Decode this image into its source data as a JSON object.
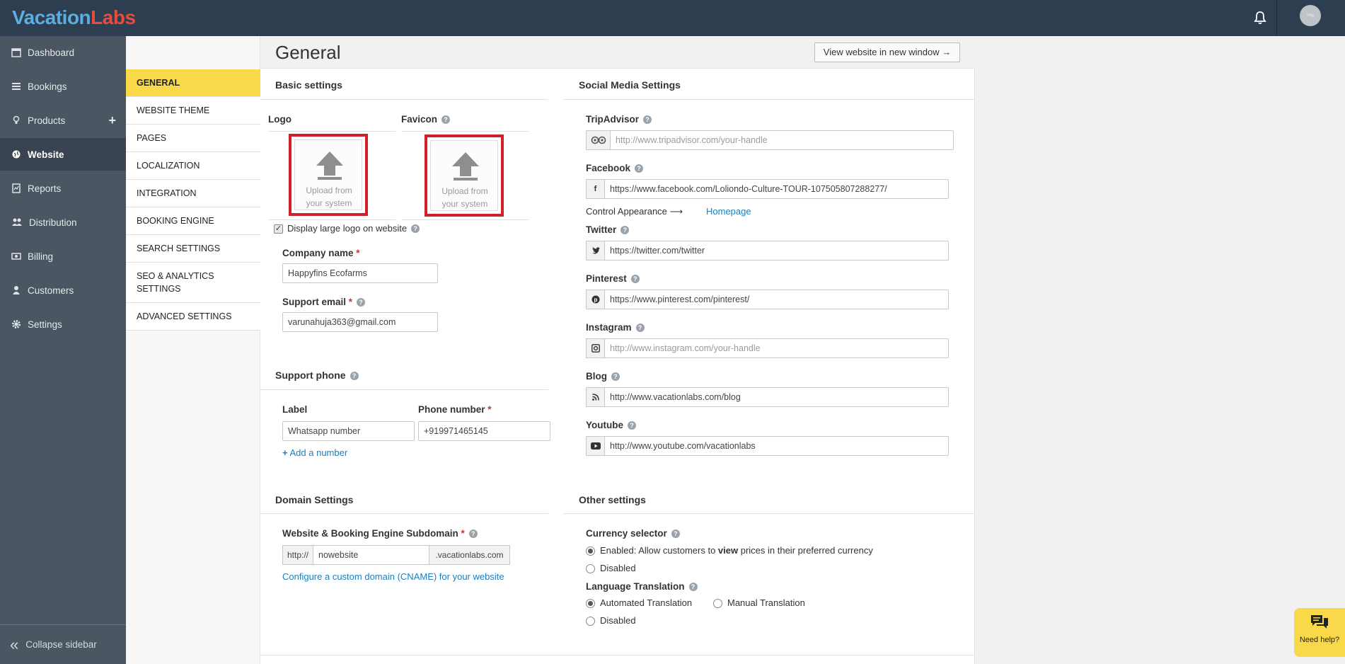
{
  "brand": {
    "part1": "Vacation",
    "part2": "Labs"
  },
  "header": {
    "avatar_text": "img"
  },
  "sidebar": {
    "items": [
      {
        "label": "Dashboard",
        "icon": "calendar-icon"
      },
      {
        "label": "Bookings",
        "icon": "list-icon"
      },
      {
        "label": "Products",
        "icon": "lightbulb-icon",
        "action": "+"
      },
      {
        "label": "Website",
        "icon": "globe-icon",
        "active": true
      },
      {
        "label": "Reports",
        "icon": "report-icon"
      },
      {
        "label": "Distribution",
        "icon": "users-icon"
      },
      {
        "label": "Billing",
        "icon": "billing-icon"
      },
      {
        "label": "Customers",
        "icon": "user-icon"
      },
      {
        "label": "Settings",
        "icon": "gear-icon"
      }
    ],
    "collapse_label": "Collapse sidebar"
  },
  "subnav": {
    "items": [
      {
        "label": "GENERAL",
        "active": true
      },
      {
        "label": "WEBSITE THEME"
      },
      {
        "label": "PAGES"
      },
      {
        "label": "LOCALIZATION"
      },
      {
        "label": "INTEGRATION"
      },
      {
        "label": "BOOKING ENGINE"
      },
      {
        "label": "SEARCH SETTINGS"
      },
      {
        "label": "SEO & ANALYTICS SETTINGS"
      },
      {
        "label": "ADVANCED SETTINGS"
      }
    ]
  },
  "page": {
    "title": "General",
    "view_button": "View website in new window →"
  },
  "basic": {
    "title": "Basic settings",
    "logo_label": "Logo",
    "favicon_label": "Favicon",
    "upload_line1": "Upload from",
    "upload_line2": "your system",
    "large_logo_label": "Display large logo on website",
    "large_logo_checked": true,
    "company_name_label": "Company name",
    "company_name_value": "Happyfins Ecofarms",
    "support_email_label": "Support email",
    "support_email_value": "varunahuja363@gmail.com",
    "required_mark": "*"
  },
  "support_phone": {
    "title": "Support phone",
    "label_header": "Label",
    "phone_header": "Phone number",
    "label_value": "Whatsapp number",
    "phone_value": "+919971465145",
    "add_link": "Add a number"
  },
  "domain": {
    "title": "Domain Settings",
    "field_label": "Website & Booking Engine Subdomain",
    "prefix": "http://",
    "value": "nowebsite",
    "suffix": ".vacationlabs.com",
    "cname_link": "Configure a custom domain (CNAME) for your website"
  },
  "social": {
    "title": "Social Media Settings",
    "tripadvisor": {
      "label": "TripAdvisor",
      "placeholder": "http://www.tripadvisor.com/your-handle",
      "icon": "tripadvisor-icon"
    },
    "facebook": {
      "label": "Facebook",
      "value": "https://www.facebook.com/Loliondo-Culture-TOUR-107505807288277/",
      "icon": "facebook-icon",
      "icon_text": "f"
    },
    "control_label": "Control Appearance ⟶",
    "control_link": "Homepage",
    "twitter": {
      "label": "Twitter",
      "value": "https://twitter.com/twitter",
      "icon": "twitter-icon"
    },
    "pinterest": {
      "label": "Pinterest",
      "value": "https://www.pinterest.com/pinterest/",
      "icon": "pinterest-icon"
    },
    "instagram": {
      "label": "Instagram",
      "placeholder": "http://www.instagram.com/your-handle",
      "icon": "instagram-icon"
    },
    "blog": {
      "label": "Blog",
      "value": "http://www.vacationlabs.com/blog",
      "icon": "rss-icon"
    },
    "youtube": {
      "label": "Youtube",
      "value": "http://www.youtube.com/vacationlabs",
      "icon": "youtube-icon"
    }
  },
  "other": {
    "title": "Other settings",
    "currency_label": "Currency selector",
    "currency_enabled_pre": "Enabled: Allow customers to ",
    "currency_enabled_bold": "view",
    "currency_enabled_post": " prices in their preferred currency",
    "currency_disabled": "Disabled",
    "currency_selected": "enabled",
    "language_label": "Language Translation",
    "language_auto": "Automated Translation",
    "language_manual": "Manual Translation",
    "language_disabled": "Disabled",
    "language_selected": "auto"
  },
  "help_widget": {
    "label": "Need help?"
  },
  "colors": {
    "topbar": "#2c3e50",
    "sidebar": "#4a5662",
    "accent_yellow": "#f9d94a",
    "link": "#1a7fc1",
    "highlight_red": "#d21f2c"
  }
}
